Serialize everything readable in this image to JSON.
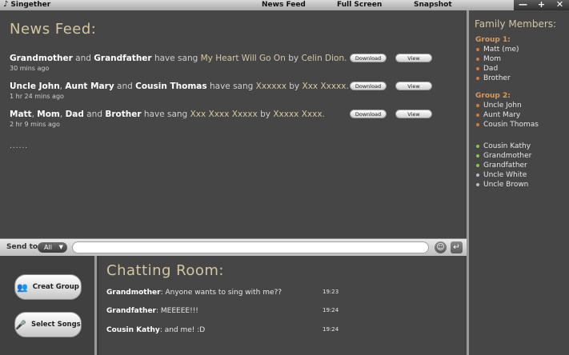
{
  "app": {
    "title": "Singether",
    "icon": "music-note-icon"
  },
  "menu": [
    {
      "label": "News Feed"
    },
    {
      "label": "Full Screen"
    },
    {
      "label": "Snapshot"
    }
  ],
  "window_controls": {
    "minimize": "—",
    "maximize": "+",
    "close": "✕"
  },
  "news_feed": {
    "title": "News Feed:",
    "items": [
      {
        "actors": [
          "Grandmother",
          "and",
          "Grandfather"
        ],
        "verb": "have sang",
        "song": "My Heart Will Go On",
        "by": "by",
        "artist": "Celin Dion.",
        "time": "30 mins ago",
        "download_label": "Download",
        "view_label": "View"
      },
      {
        "actors": [
          "Uncle John",
          ",",
          "Aunt Mary",
          "and",
          "Cousin Thomas"
        ],
        "verb": "have sang",
        "song": "Xxxxxx",
        "by": "by",
        "artist": "Xxx Xxxxx.",
        "time": "1 hr 24 mins ago",
        "download_label": "Download",
        "view_label": "View"
      },
      {
        "actors": [
          "Matt",
          ",",
          "Mom",
          ",",
          "Dad",
          "and",
          "Brother"
        ],
        "verb": "have sang",
        "song": "Xxx Xxxx Xxxxx",
        "by": "by",
        "artist": "Xxxxx Xxxx.",
        "time": "2 hr 9 mins ago",
        "download_label": "Download",
        "view_label": "View"
      }
    ],
    "more": "......"
  },
  "send_bar": {
    "label": "Send to",
    "selected": "All",
    "input_value": "",
    "emoji_icon": "smiley-icon",
    "enter_icon": "enter-icon"
  },
  "left_panel": {
    "create_group": "Creat Group",
    "select_songs": "Select Songs"
  },
  "chat_room": {
    "title": "Chatting Room:",
    "messages": [
      {
        "user": "Grandmother",
        "text": ": Anyone wants to sing with me??",
        "time": "19:23"
      },
      {
        "user": "Grandfather",
        "text": ": MEEEEE!!!",
        "time": "19:24"
      },
      {
        "user": "Cousin Kathy",
        "text": ": and me! :D",
        "time": "19:24"
      }
    ]
  },
  "family": {
    "title": "Family Members:",
    "group1": {
      "label": "Group 1:",
      "members": [
        "Matt (me)",
        "Mom",
        "Dad",
        "Brother"
      ]
    },
    "group2": {
      "label": "Group 2:",
      "members": [
        "Uncle John",
        "Aunt Mary",
        "Cousin Thomas"
      ]
    },
    "others": [
      {
        "name": "Cousin Kathy",
        "status": "online"
      },
      {
        "name": "Grandmother",
        "status": "online"
      },
      {
        "name": "Grandfather",
        "status": "online"
      },
      {
        "name": "Uncle White",
        "status": "offline"
      },
      {
        "name": "Uncle Brown",
        "status": "offline"
      }
    ]
  },
  "colors": {
    "accent": "#d5c6a2",
    "group_label": "#d89a5a",
    "online": "#8bc34a",
    "offline": "#bdbdbd",
    "group_member": "#d8773a"
  }
}
